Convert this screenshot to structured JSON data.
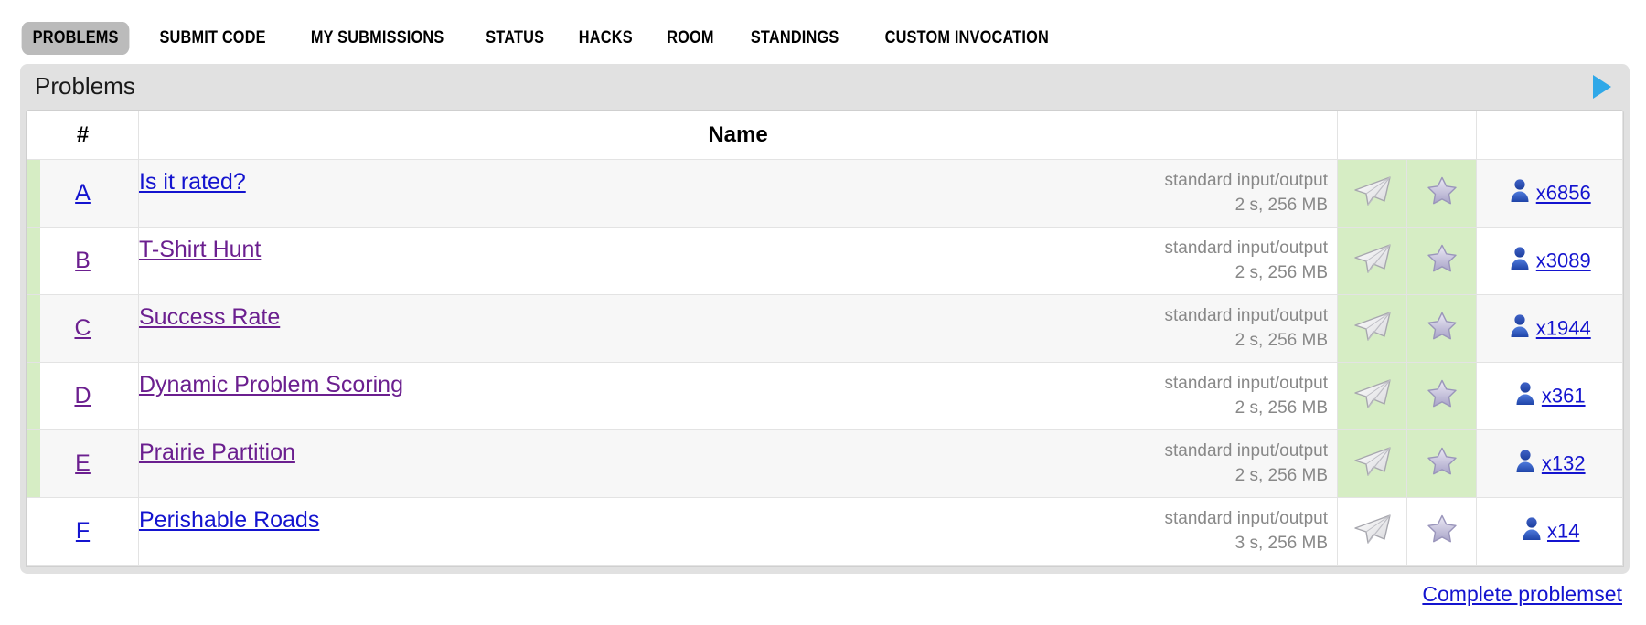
{
  "nav": {
    "items": [
      {
        "label": "PROBLEMS",
        "active": true
      },
      {
        "label": "SUBMIT CODE",
        "active": false
      },
      {
        "label": "MY SUBMISSIONS",
        "active": false
      },
      {
        "label": "STATUS",
        "active": false
      },
      {
        "label": "HACKS",
        "active": false
      },
      {
        "label": "ROOM",
        "active": false
      },
      {
        "label": "STANDINGS",
        "active": false
      },
      {
        "label": "CUSTOM INVOCATION",
        "active": false
      }
    ]
  },
  "panel": {
    "title": "Problems",
    "expand_icon": "play-triangle-right-icon"
  },
  "table": {
    "headers": {
      "index": "#",
      "name": "Name",
      "plane": "",
      "star": "",
      "users": ""
    },
    "rows": [
      {
        "index": "A",
        "index_visited": false,
        "name": "Is it rated?",
        "name_visited": false,
        "io": "standard input/output",
        "limits": "2 s, 256 MB",
        "solved": true,
        "solvers": "x6856",
        "plane_icon": "paper-plane-icon",
        "star_icon": "star-icon",
        "user_icon": "user-icon"
      },
      {
        "index": "B",
        "index_visited": true,
        "name": "T-Shirt Hunt",
        "name_visited": true,
        "io": "standard input/output",
        "limits": "2 s, 256 MB",
        "solved": true,
        "solvers": "x3089",
        "plane_icon": "paper-plane-icon",
        "star_icon": "star-icon",
        "user_icon": "user-icon"
      },
      {
        "index": "C",
        "index_visited": true,
        "name": "Success Rate",
        "name_visited": true,
        "io": "standard input/output",
        "limits": "2 s, 256 MB",
        "solved": true,
        "solvers": "x1944",
        "plane_icon": "paper-plane-icon",
        "star_icon": "star-icon",
        "user_icon": "user-icon"
      },
      {
        "index": "D",
        "index_visited": true,
        "name": "Dynamic Problem Scoring",
        "name_visited": true,
        "io": "standard input/output",
        "limits": "2 s, 256 MB",
        "solved": true,
        "solvers": "x361",
        "plane_icon": "paper-plane-icon",
        "star_icon": "star-icon",
        "user_icon": "user-icon"
      },
      {
        "index": "E",
        "index_visited": true,
        "name": "Prairie Partition",
        "name_visited": true,
        "io": "standard input/output",
        "limits": "2 s, 256 MB",
        "solved": true,
        "solvers": "x132",
        "plane_icon": "paper-plane-icon",
        "star_icon": "star-icon",
        "user_icon": "user-icon"
      },
      {
        "index": "F",
        "index_visited": false,
        "name": "Perishable Roads",
        "name_visited": false,
        "io": "standard input/output",
        "limits": "3 s, 256 MB",
        "solved": false,
        "solvers": "x14",
        "plane_icon": "paper-plane-icon",
        "star_icon": "star-icon",
        "user_icon": "user-icon"
      }
    ]
  },
  "footer": {
    "complete_problemset_label": "Complete problemset"
  },
  "colors": {
    "link": "#1414cf",
    "link_visited": "#6b1f8f",
    "solved_green": "#d6edc4",
    "panel_grey": "#e1e1e1",
    "active_tab_grey": "#bbbbbb",
    "meta_grey": "#888888",
    "arrow_blue": "#2fa8e8"
  }
}
